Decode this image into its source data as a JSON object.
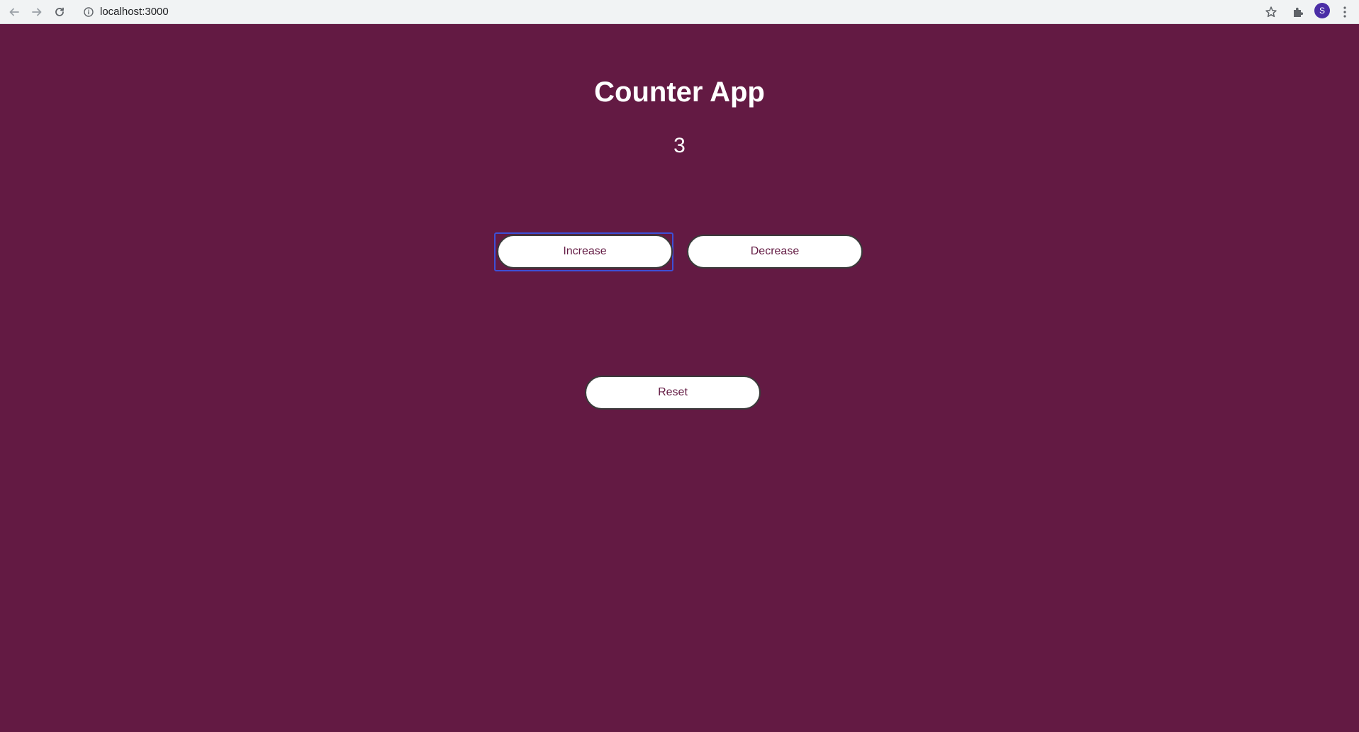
{
  "browser": {
    "url": "localhost:3000",
    "profile_initial": "S",
    "icons": {
      "back": "arrow-left-icon",
      "forward": "arrow-right-icon",
      "reload": "reload-icon",
      "info": "info-icon",
      "bookmark": "star-icon",
      "extensions": "puzzle-icon",
      "menu": "kebab-menu-icon"
    }
  },
  "app": {
    "title": "Counter App",
    "count": "3",
    "buttons": {
      "increase": "Increase",
      "decrease": "Decrease",
      "reset": "Reset"
    }
  },
  "colors": {
    "background": "#631a43",
    "button_bg": "#ffffff",
    "button_text": "#631a43",
    "focus_ring": "#3d4fd6",
    "avatar": "#4b2ea6"
  }
}
